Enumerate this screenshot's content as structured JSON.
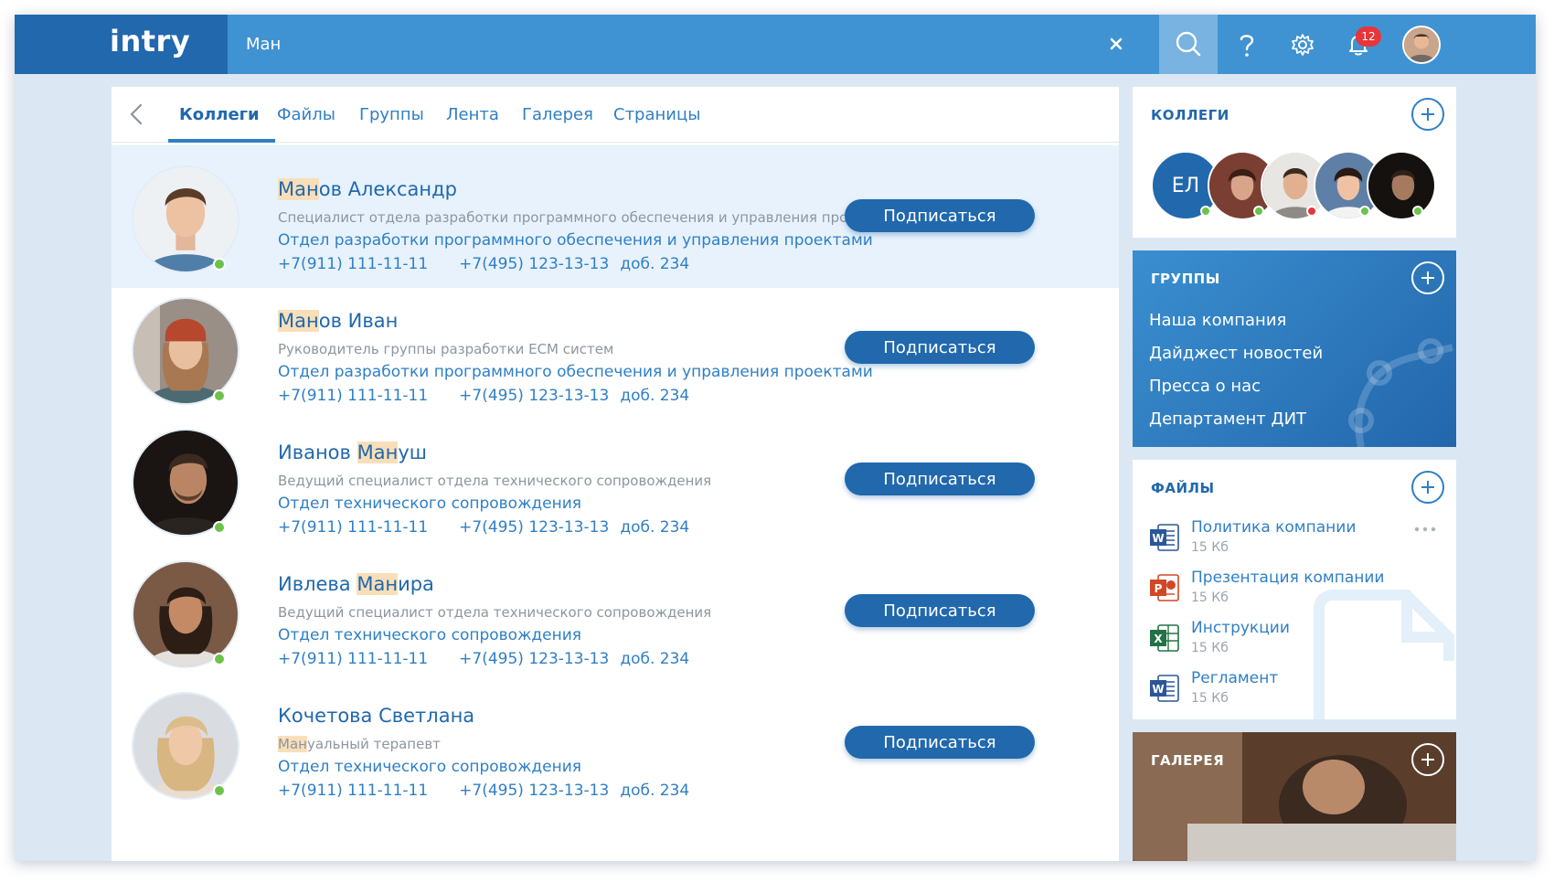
{
  "app": {
    "logo": "intry"
  },
  "search": {
    "value": "Ман"
  },
  "notifications": {
    "count": "12"
  },
  "tabs": [
    {
      "label": "Коллеги",
      "active": true
    },
    {
      "label": "Файлы"
    },
    {
      "label": "Группы"
    },
    {
      "label": "Лента"
    },
    {
      "label": "Галерея"
    },
    {
      "label": "Страницы"
    }
  ],
  "people": [
    {
      "name_hl": "Ман",
      "name_rest": "ов Александр",
      "position": "Специалист отдела разработки программного обеспечения и управления проектами",
      "department": "Отдел разработки программного обеспечения и управления проектами",
      "phone1": "+7(911) 111-11-11",
      "phone2": "+7(495) 123-13-13",
      "ext": "доб. 234",
      "subscribe": "Подписаться"
    },
    {
      "name_hl": "Ман",
      "name_rest": "ов Иван",
      "position": "Руководитель группы разработки ECM систем",
      "department": "Отдел разработки программного обеспечения и управления проектами",
      "phone1": "+7(911) 111-11-11",
      "phone2": "+7(495) 123-13-13",
      "ext": "доб. 234",
      "subscribe": "Подписаться"
    },
    {
      "name_pre": "Иванов ",
      "name_hl": "Ман",
      "name_rest": "уш",
      "position": "Ведущий специалист отдела технического сопровождения",
      "department": "Отдел технического сопровождения",
      "phone1": "+7(911) 111-11-11",
      "phone2": "+7(495) 123-13-13",
      "ext": "доб. 234",
      "subscribe": "Подписаться"
    },
    {
      "name_pre": "Ивлева ",
      "name_hl": "Ман",
      "name_rest": "ира",
      "position": "Ведущий специалист отдела технического сопровождения",
      "department": "Отдел технического сопровождения",
      "phone1": "+7(911) 111-11-11",
      "phone2": "+7(495) 123-13-13",
      "ext": "доб. 234",
      "subscribe": "Подписаться"
    },
    {
      "name": "Кочетова Светлана",
      "pos_hl": "Ман",
      "pos_rest": "уальный терапевт",
      "department": "Отдел технического сопровождения",
      "phone1": "+7(911) 111-11-11",
      "phone2": "+7(495) 123-13-13",
      "ext": "доб. 234",
      "subscribe": "Подписаться"
    }
  ],
  "sidebar": {
    "colleagues": {
      "title": "КОЛЛЕГИ",
      "initials": "ЕЛ"
    },
    "groups": {
      "title": "ГРУППЫ",
      "items": [
        "Наша компания",
        "Дайджест новостей",
        "Пресса о нас",
        "Департамент ДИТ"
      ]
    },
    "files": {
      "title": "ФАЙЛЫ",
      "items": [
        {
          "name": "Политика компании",
          "size": "15 Кб",
          "type": "word"
        },
        {
          "name": "Презентация компании",
          "size": "15 Кб",
          "type": "powerpoint"
        },
        {
          "name": "Инструкции",
          "size": "15 Кб",
          "type": "excel"
        },
        {
          "name": "Регламент",
          "size": "15 Кб",
          "type": "word"
        }
      ]
    },
    "gallery": {
      "title": "ГАЛЕРЕЯ"
    }
  },
  "colors": {
    "primary": "#2168ad",
    "topbar": "#3f93d2",
    "highlight": "#f9dfb9",
    "online": "#6cc24a",
    "offline": "#e8353a"
  }
}
